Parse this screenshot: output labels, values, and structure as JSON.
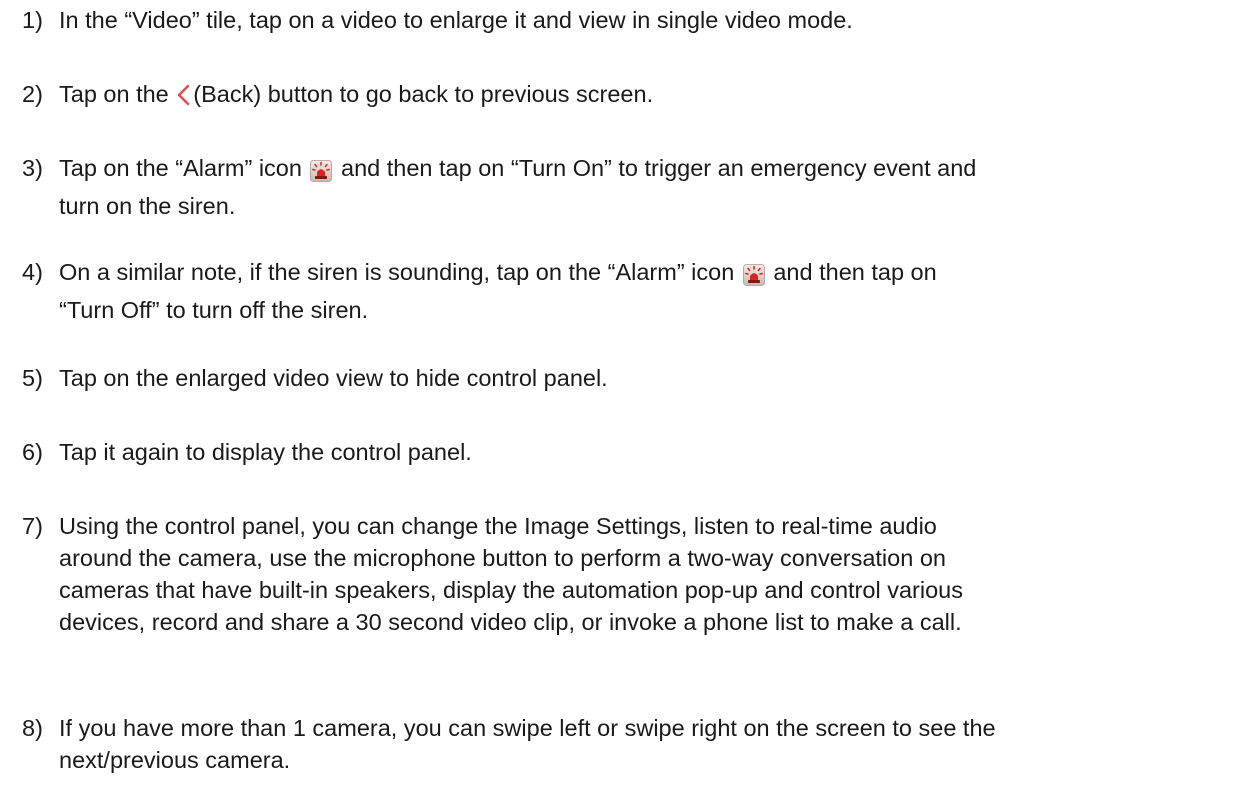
{
  "steps": [
    {
      "number": "1)",
      "text": "In the “Video” tile, tap on a video to enlarge it and view in single video mode."
    },
    {
      "number": "2)",
      "before": "Tap on the",
      "icon": "back-chevron-icon",
      "after": "(Back) button to go back to previous screen."
    },
    {
      "number": "3)",
      "before": "Tap on the “Alarm” icon",
      "icon": "alarm-siren-icon",
      "after": "and then tap on “Turn On” to trigger an emergency event and",
      "line2": "turn on the siren."
    },
    {
      "number": "4)",
      "before": "On a similar note, if the siren is sounding, tap on the “Alarm” icon",
      "icon": "alarm-siren-icon",
      "after": "and then tap on",
      "line2": "“Turn Off” to turn off the siren."
    },
    {
      "number": "5)",
      "text": "Tap on the enlarged video view to hide control panel."
    },
    {
      "number": "6)",
      "text": "Tap it again to display the control panel."
    },
    {
      "number": "7)",
      "lines": [
        "Using the control panel, you can change the Image Settings, listen to real-time audio",
        "around the camera, use the microphone button to perform a two-way conversation on",
        "cameras that have built-in speakers, display the automation pop-up and control various",
        "devices, record and share a 30 second video clip, or invoke a phone list to make a call."
      ]
    },
    {
      "number": "8)",
      "lines": [
        "If you have more than 1 camera, you can swipe left or swipe right on the screen to see the",
        "next/previous camera."
      ]
    }
  ],
  "colors": {
    "text": "#1a1a1a",
    "back_icon": "#e8474f",
    "alarm_icon": "#c8201c"
  }
}
